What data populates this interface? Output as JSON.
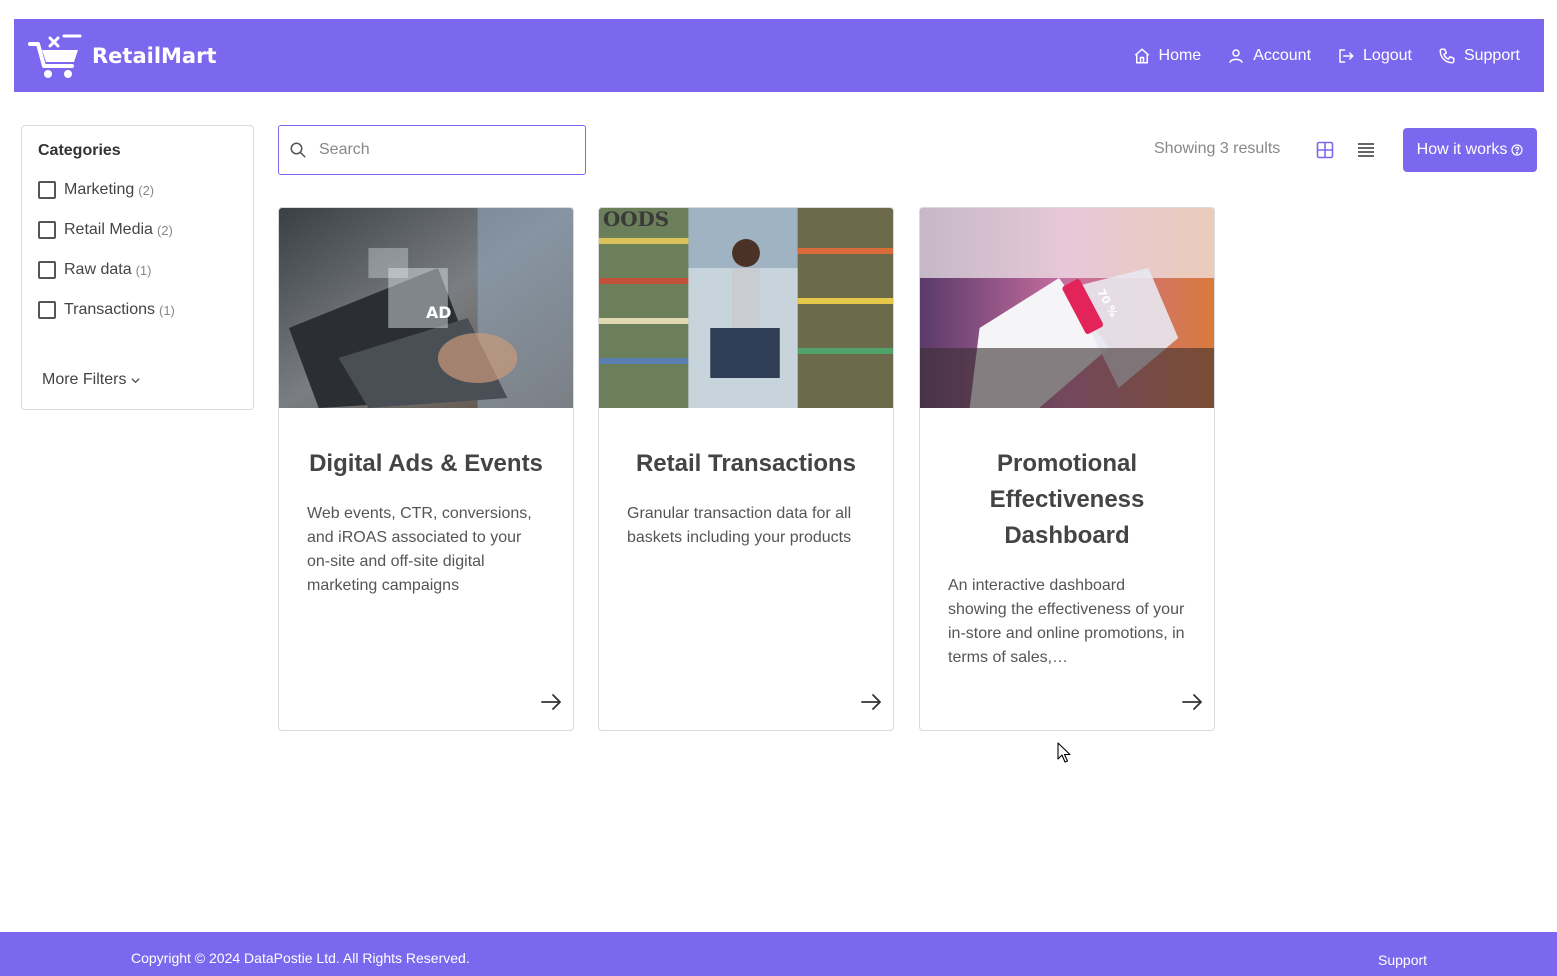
{
  "header": {
    "brand": "RetailMart",
    "nav": [
      {
        "label": "Home",
        "icon": "home-icon"
      },
      {
        "label": "Account",
        "icon": "user-icon"
      },
      {
        "label": "Logout",
        "icon": "logout-icon"
      },
      {
        "label": "Support",
        "icon": "phone-icon"
      }
    ]
  },
  "sidebar": {
    "title": "Categories",
    "categories": [
      {
        "label": "Marketing",
        "count": "(2)"
      },
      {
        "label": "Retail Media",
        "count": "(2)"
      },
      {
        "label": "Raw data",
        "count": "(1)"
      },
      {
        "label": "Transactions",
        "count": "(1)"
      }
    ],
    "more_filters": "More Filters"
  },
  "toolbar": {
    "search_placeholder": "Search",
    "results_text": "Showing 3 results",
    "how_it_works": "How it works"
  },
  "cards": [
    {
      "title": "Digital Ads & Events",
      "description": "Web events, CTR, conversions, and iROAS associated to your on-site and off-site digital marketing campaigns"
    },
    {
      "title": "Retail Transactions",
      "description": "Granular transaction data for all baskets including your products"
    },
    {
      "title": "Promotional Effectiveness Dashboard",
      "description": "An interactive dashboard showing the effectiveness of your in-store and online promotions, in terms of sales,…",
      "badge": "70 %"
    }
  ],
  "footer": {
    "copyright": "Copyright © 2024 DataPostie Ltd. All Rights Reserved.",
    "support": "Support"
  },
  "colors": {
    "accent": "#7b68ee",
    "border": "#d9d9e0",
    "text": "#444444"
  }
}
